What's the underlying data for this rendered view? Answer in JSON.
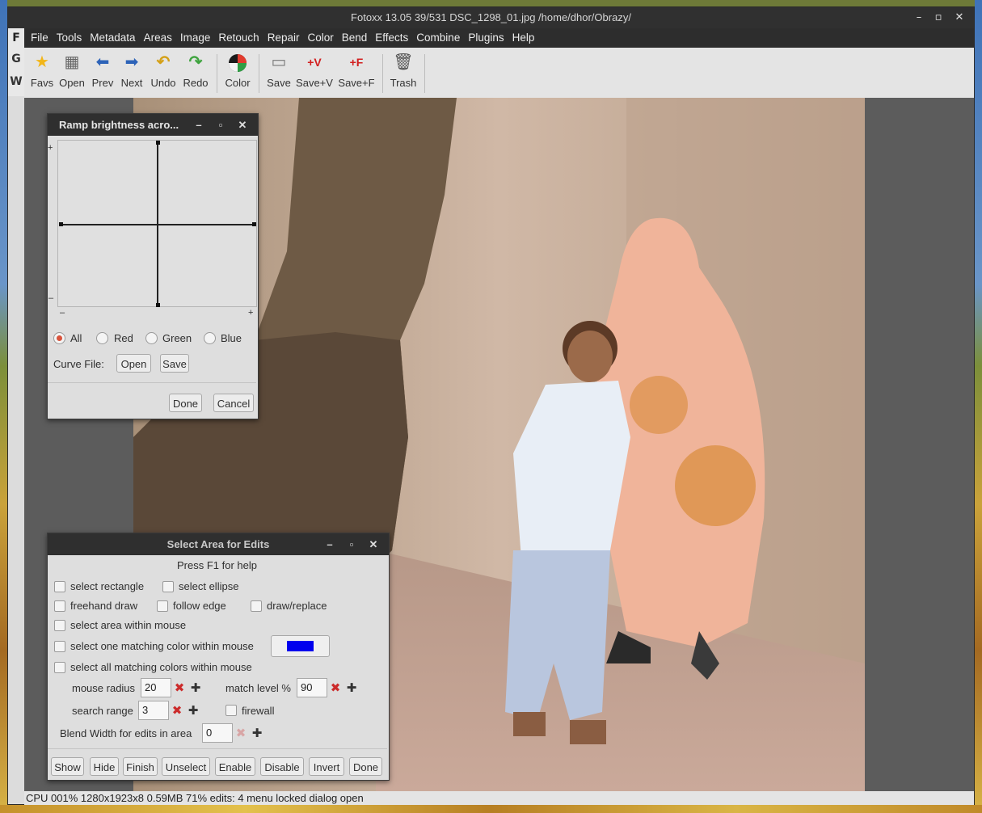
{
  "window": {
    "title": "Fotoxx 13.05  39/531  DSC_1298_01.jpg  /home/dhor/Obrazy/",
    "controls": {
      "minimize": "–",
      "maximize": "▫",
      "close": "✕"
    }
  },
  "menubar": {
    "mode_letter": "F",
    "items": [
      "File",
      "Tools",
      "Metadata",
      "Areas",
      "Image",
      "Retouch",
      "Repair",
      "Color",
      "Bend",
      "Effects",
      "Combine",
      "Plugins",
      "Help"
    ]
  },
  "side_tabs": [
    "G",
    "W"
  ],
  "toolbar": {
    "items": [
      {
        "label": "Favs",
        "icon": "★"
      },
      {
        "label": "Open",
        "icon": "▦"
      },
      {
        "label": "Prev",
        "icon": "⬅"
      },
      {
        "label": "Next",
        "icon": "➡"
      },
      {
        "label": "Undo",
        "icon": "↶"
      },
      {
        "label": "Redo",
        "icon": "↷"
      },
      {
        "label": "Color",
        "icon": "◕"
      },
      {
        "label": "Save",
        "icon": "▭"
      },
      {
        "label": "Save+V",
        "icon": "+V"
      },
      {
        "label": "Save+F",
        "icon": "+F"
      },
      {
        "label": "Trash",
        "icon": "🗑"
      }
    ]
  },
  "status": {
    "text": "CPU 001%  1280x1923x8  0.59MB  71%  edits: 4  menu locked  dialog open"
  },
  "ramp_dialog": {
    "title": "Ramp brightness acro...",
    "axis_plus_top": "+",
    "axis_minus_left": "–",
    "axis_minus_bottom": "–",
    "axis_plus_right": "+",
    "channels": [
      {
        "label": "All",
        "selected": true
      },
      {
        "label": "Red",
        "selected": false
      },
      {
        "label": "Green",
        "selected": false
      },
      {
        "label": "Blue",
        "selected": false
      }
    ],
    "curve_file_label": "Curve File:",
    "open_label": "Open",
    "save_label": "Save",
    "done_label": "Done",
    "cancel_label": "Cancel"
  },
  "select_dialog": {
    "title": "Select Area for Edits",
    "help": "Press F1 for help",
    "options": {
      "rect": "select rectangle",
      "ellipse": "select ellipse",
      "freehand": "freehand draw",
      "follow": "follow edge",
      "draw_replace": "draw/replace",
      "area_mouse": "select area within mouse",
      "one_color": "select one matching color within mouse",
      "all_colors": "select all matching colors within mouse"
    },
    "match_color": "#0000ee",
    "mouse_radius_label": "mouse radius",
    "mouse_radius_value": "20",
    "match_level_label": "match level %",
    "match_level_value": "90",
    "search_range_label": "search range",
    "search_range_value": "3",
    "firewall_label": "firewall",
    "blend_label": "Blend Width for edits in area",
    "blend_value": "0",
    "minus_symbol": "✖",
    "plus_symbol": "✚",
    "buttons": [
      "Show",
      "Hide",
      "Finish",
      "Unselect",
      "Enable",
      "Disable",
      "Invert",
      "Done"
    ]
  }
}
